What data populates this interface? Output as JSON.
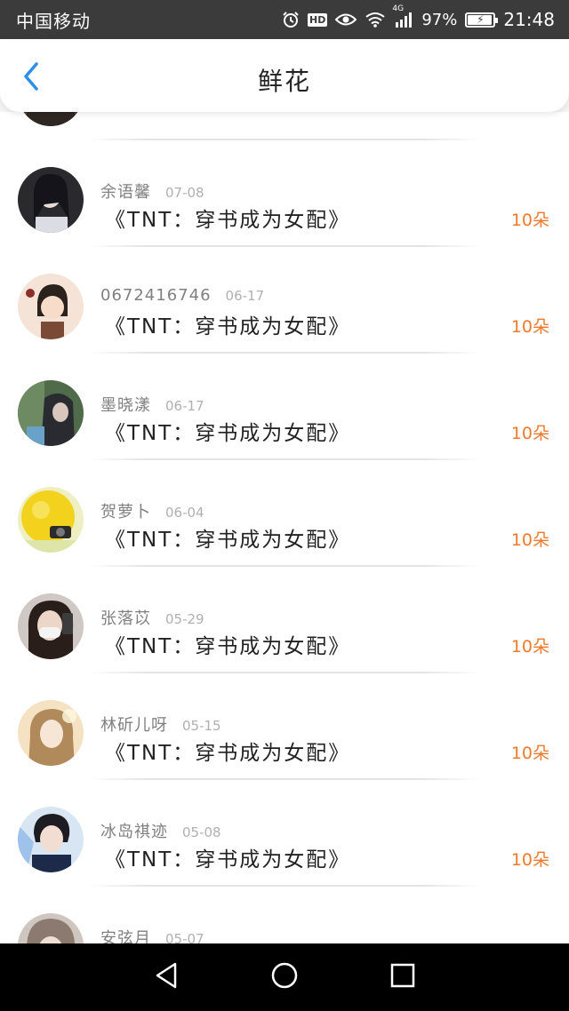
{
  "status_bar": {
    "carrier": "中国移动",
    "hd": "HD",
    "network": "4G",
    "battery": "97%",
    "battery_level": 0.97,
    "time": "21:48"
  },
  "header": {
    "title": "鲜花",
    "back_icon": "chevron-left-icon"
  },
  "colors": {
    "accent_blue": "#2f8fe6",
    "amount_orange": "#ef7a2e",
    "name_gray": "#808080",
    "date_gray": "#b0b0b0"
  },
  "rows": [
    {
      "name": "",
      "date": "",
      "book": "",
      "amount": ""
    },
    {
      "name": "余语馨",
      "date": "07-08",
      "book": "《TNT：穿书成为女配》",
      "amount": "10朵"
    },
    {
      "name": "0672416746",
      "date": "06-17",
      "book": "《TNT：穿书成为女配》",
      "amount": "10朵"
    },
    {
      "name": "墨晓漾",
      "date": "06-17",
      "book": "《TNT：穿书成为女配》",
      "amount": "10朵"
    },
    {
      "name": "贺萝卜",
      "date": "06-04",
      "book": "《TNT：穿书成为女配》",
      "amount": "10朵"
    },
    {
      "name": "张落苡",
      "date": "05-29",
      "book": "《TNT：穿书成为女配》",
      "amount": "10朵"
    },
    {
      "name": "林斫儿呀",
      "date": "05-15",
      "book": "《TNT：穿书成为女配》",
      "amount": "10朵"
    },
    {
      "name": "冰岛祺迹",
      "date": "05-08",
      "book": "《TNT：穿书成为女配》",
      "amount": "10朵"
    },
    {
      "name": "安弦月",
      "date": "05-07",
      "book": "",
      "amount": ""
    }
  ],
  "nav_bar": {
    "back_icon": "triangle-back-icon",
    "home_icon": "circle-home-icon",
    "recents_icon": "square-recents-icon"
  }
}
